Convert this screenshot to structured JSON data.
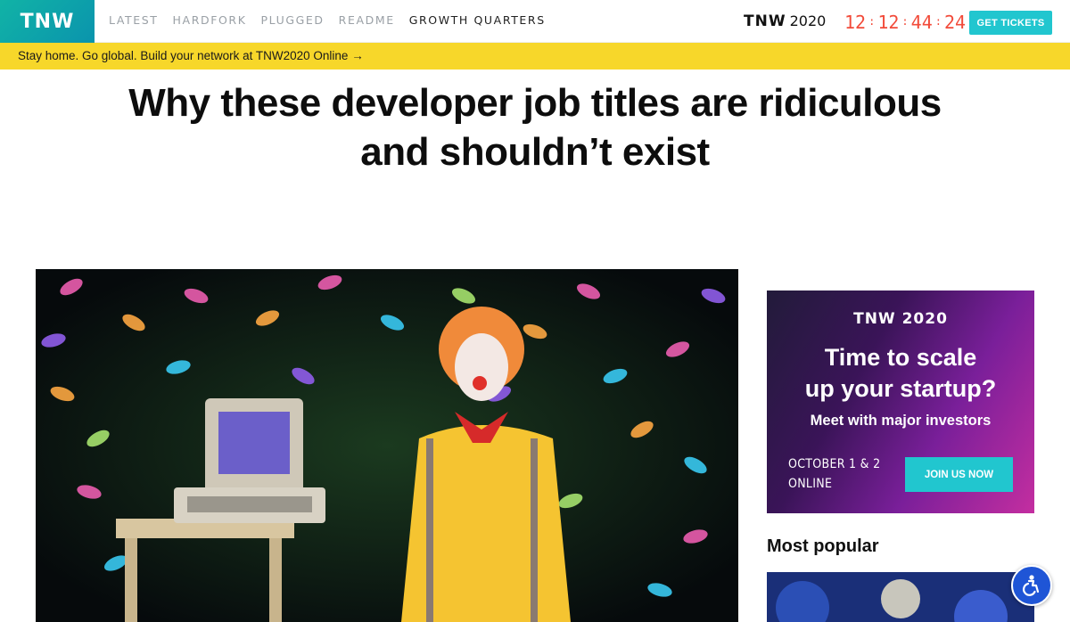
{
  "header": {
    "logo": "TNW",
    "nav": [
      {
        "label": "LATEST",
        "active": false
      },
      {
        "label": "HARDFORK",
        "active": false
      },
      {
        "label": "PLUGGED",
        "active": false
      },
      {
        "label": "README",
        "active": false
      },
      {
        "label": "GROWTH QUARTERS",
        "active": true
      }
    ],
    "event_brand": "TNW",
    "event_year": "2020",
    "countdown": [
      "12",
      "12",
      "44",
      "24"
    ],
    "tickets_label": "GET TICKETS"
  },
  "banner": {
    "text": "Stay home. Go global. Build your network at TNW2020 Online →"
  },
  "article": {
    "title_line1": "Why these developer job titles are ridiculous",
    "title_line2": "and shouldn’t exist",
    "hero_icon": "clown-developer-image"
  },
  "sidebar": {
    "ad": {
      "brand": "TNW 2020",
      "headline_line1": "Time to scale",
      "headline_line2": "up your startup?",
      "sub": "Meet with major investors",
      "date_line1": "OCTOBER 1 & 2",
      "date_line2": "ONLINE",
      "cta": "JOIN US NOW"
    },
    "most_popular": "Most popular"
  },
  "colors": {
    "accent": "#21c6cf",
    "banner": "#f7d72a",
    "countdown": "#f24b3a",
    "a11y": "#1f55d6"
  },
  "icons": {
    "accessibility": "accessibility-icon"
  }
}
